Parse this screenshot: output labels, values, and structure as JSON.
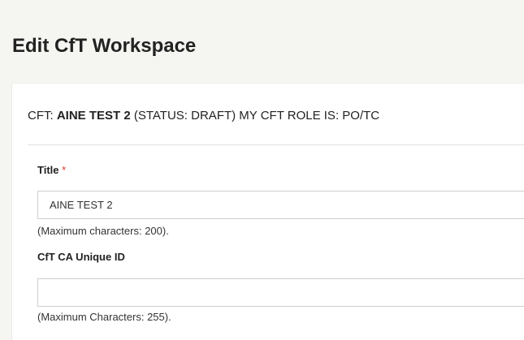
{
  "page": {
    "title": "Edit CfT Workspace"
  },
  "cft_summary": {
    "prefix": "CFT: ",
    "name": "AINE TEST 2",
    "status_text": " (STATUS: DRAFT) MY CFT ROLE IS: PO/TC"
  },
  "form": {
    "title_field": {
      "label": "Title",
      "required_marker": "*",
      "value": "AINE TEST 2",
      "help": "(Maximum characters: 200)."
    },
    "unique_id_field": {
      "label": "CfT CA Unique ID",
      "value": "",
      "help": "(Maximum Characters: 255)."
    }
  }
}
